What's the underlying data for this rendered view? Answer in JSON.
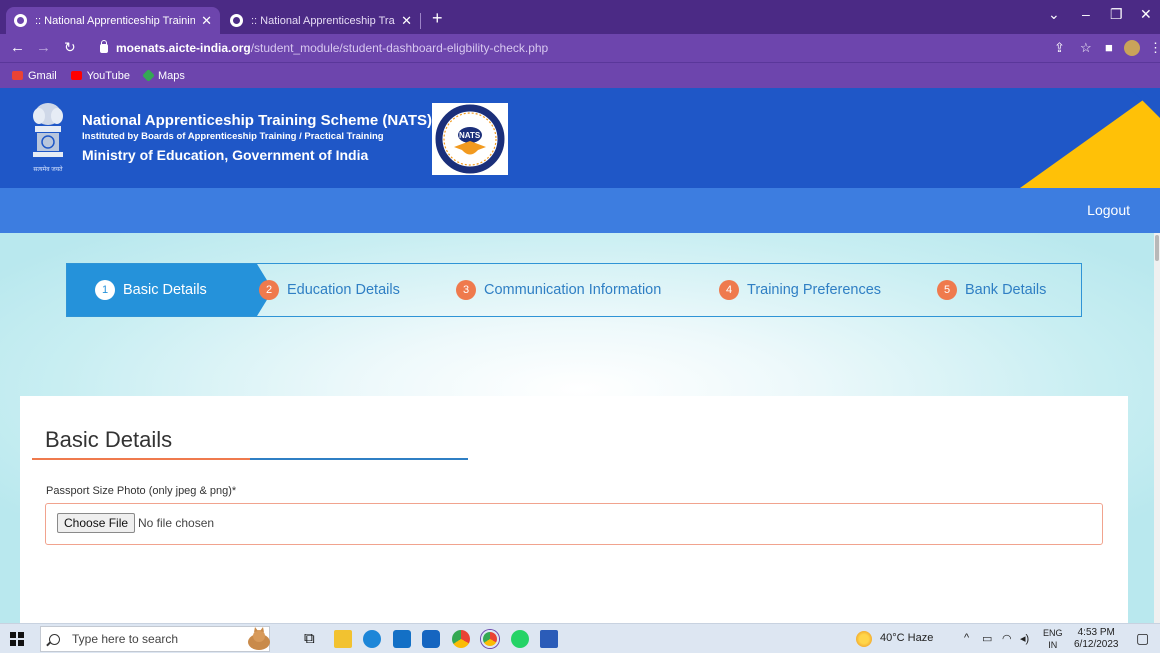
{
  "browser": {
    "tabs": [
      {
        "title": ":: National Apprenticeship Trainin",
        "active": true
      },
      {
        "title": ":: National Apprenticeship Trainin",
        "active": false
      }
    ],
    "new_tab": "+",
    "url_host": "moenats.aicte-india.org",
    "url_path": "/student_module/student-dashboard-eligbility-check.php",
    "bookmarks": [
      "Gmail",
      "YouTube",
      "Maps"
    ]
  },
  "header": {
    "line1": "National Apprenticeship Training Scheme (NATS)",
    "line2": "Instituted by Boards of Apprenticeship Training / Practical Training",
    "line3": "Ministry of Education, Government of India",
    "emblem_caption": "सत्यमेव जयते",
    "logo_text": "NATS",
    "logout": "Logout"
  },
  "steps": [
    {
      "num": "1",
      "label": "Basic Details",
      "active": true
    },
    {
      "num": "2",
      "label": "Education Details",
      "active": false
    },
    {
      "num": "3",
      "label": "Communication Information",
      "active": false
    },
    {
      "num": "4",
      "label": "Training Preferences",
      "active": false
    },
    {
      "num": "5",
      "label": "Bank Details",
      "active": false
    }
  ],
  "form": {
    "title": "Basic Details",
    "photo_label": "Passport Size Photo (only jpeg & png)*",
    "choose_file": "Choose File",
    "no_file": "No file chosen"
  },
  "taskbar": {
    "search_placeholder": "Type here to search",
    "weather": "40°C  Haze",
    "lang1": "ENG",
    "lang2": "IN",
    "time": "4:53 PM",
    "date": "6/12/2023"
  },
  "colors": {
    "browser_chrome": "#4b2a85",
    "header_blue": "#1f57c7",
    "nav_blue": "#3d7de0",
    "step_active": "#2592da",
    "step_badge": "#ef7a4d",
    "header_accent": "#ffc107"
  }
}
